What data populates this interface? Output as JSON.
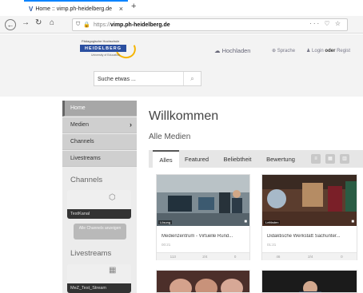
{
  "browser": {
    "tab_title": "Home :: vimp.ph-heidelberg.de",
    "tab_close": "×",
    "new_tab": "+",
    "url_proto": "https://",
    "url_host": "vimp.ph-heidelberg.de",
    "url_actions": "··· ♡ ☆"
  },
  "header": {
    "logo_small": "Pädagogische Hochschule",
    "logo_name": "HEIDELBERG",
    "logo_sub": "University of Education",
    "upload_label": "Hochladen",
    "language_label": "Sprache",
    "login_label": "Login",
    "login_or": "oder",
    "register_label": "Regist"
  },
  "search": {
    "placeholder": "Suche etwas ..."
  },
  "sidebar": {
    "nav": [
      {
        "label": "Home"
      },
      {
        "label": "Medien"
      },
      {
        "label": "Channels"
      },
      {
        "label": "Livestreams"
      }
    ],
    "channels_heading": "Channels",
    "channel_caption": "TestKanal",
    "all_channels_button": "Alle Channels anzeigen",
    "livestreams_heading": "Livestreams",
    "stream_caption": "MeZ_Test_Stream"
  },
  "main": {
    "title": "Willkommen",
    "subtitle": "Alle Medien",
    "tabs": [
      {
        "label": "Alles"
      },
      {
        "label": "Featured"
      },
      {
        "label": "Beliebtheit"
      },
      {
        "label": "Bewertung"
      }
    ],
    "cards": [
      {
        "title": "Medienzentrum - Virtuelle Rund...",
        "duration": "Lösung",
        "time": "00:21",
        "views": "113",
        "likes": "2/4",
        "comments": "0"
      },
      {
        "title": "Didaktische Werkstatt Sachunter...",
        "duration": "Leitfaden",
        "time": "01:21",
        "views": "46",
        "likes": "2/4",
        "comments": "0"
      }
    ]
  },
  "colors": {
    "brand_blue": "#2b4fa0",
    "brand_yellow": "#f5b400",
    "firefox_accent": "#0a84ff"
  }
}
